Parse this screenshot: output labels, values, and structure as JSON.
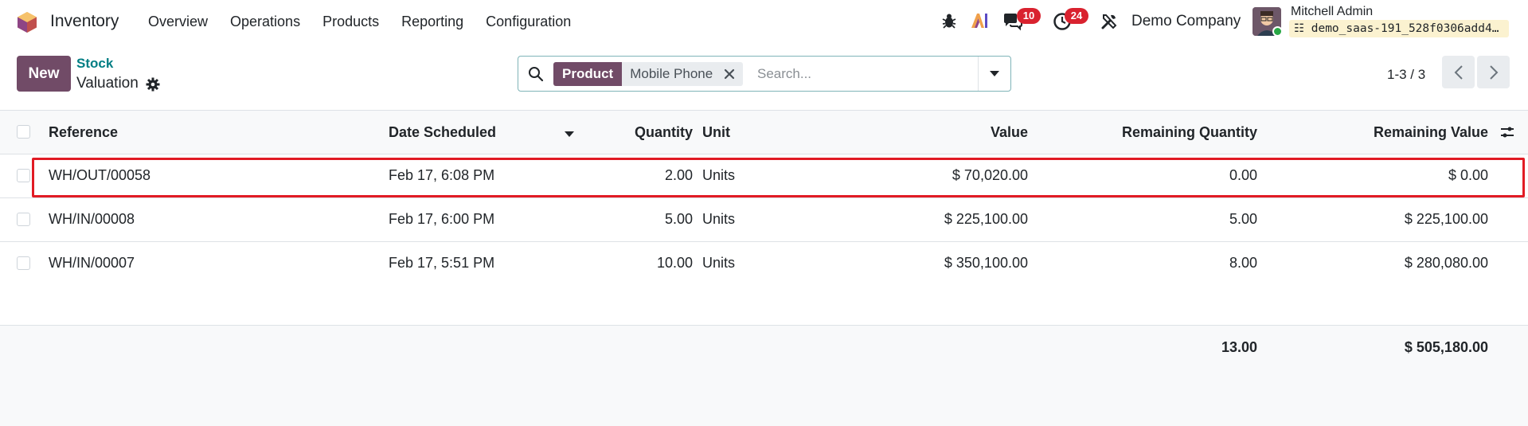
{
  "navbar": {
    "app_name": "Inventory",
    "menu": [
      "Overview",
      "Operations",
      "Products",
      "Reporting",
      "Configuration"
    ],
    "messages_count": "10",
    "activities_count": "24",
    "company": "Demo Company",
    "user_name": "Mitchell Admin",
    "database": "demo_saas-191_528f0306add4…"
  },
  "control": {
    "new_label": "New",
    "breadcrumb_parent": "Stock",
    "breadcrumb_current": "Valuation",
    "facet_label": "Product",
    "facet_value": "Mobile Phone",
    "search_placeholder": "Search...",
    "pager": "1-3 / 3"
  },
  "list": {
    "columns": {
      "reference": "Reference",
      "date": "Date Scheduled",
      "quantity": "Quantity",
      "unit": "Unit",
      "value": "Value",
      "remaining_quantity": "Remaining Quantity",
      "remaining_value": "Remaining Value"
    },
    "rows": [
      {
        "reference": "WH/OUT/00058",
        "date": "Feb 17, 6:08 PM",
        "quantity": "2.00",
        "unit": "Units",
        "value": "$ 70,020.00",
        "remaining_quantity": "0.00",
        "remaining_value": "$ 0.00"
      },
      {
        "reference": "WH/IN/00008",
        "date": "Feb 17, 6:00 PM",
        "quantity": "5.00",
        "unit": "Units",
        "value": "$ 225,100.00",
        "remaining_quantity": "5.00",
        "remaining_value": "$ 225,100.00"
      },
      {
        "reference": "WH/IN/00007",
        "date": "Feb 17, 5:51 PM",
        "quantity": "10.00",
        "unit": "Units",
        "value": "$ 350,100.00",
        "remaining_quantity": "8.00",
        "remaining_value": "$ 280,080.00"
      }
    ],
    "totals": {
      "remaining_quantity": "13.00",
      "remaining_value": "$ 505,180.00"
    }
  },
  "colors": {
    "brand": "#714b67",
    "link": "#017e84",
    "badge": "#d9222f",
    "highlight": "#e11b24"
  }
}
